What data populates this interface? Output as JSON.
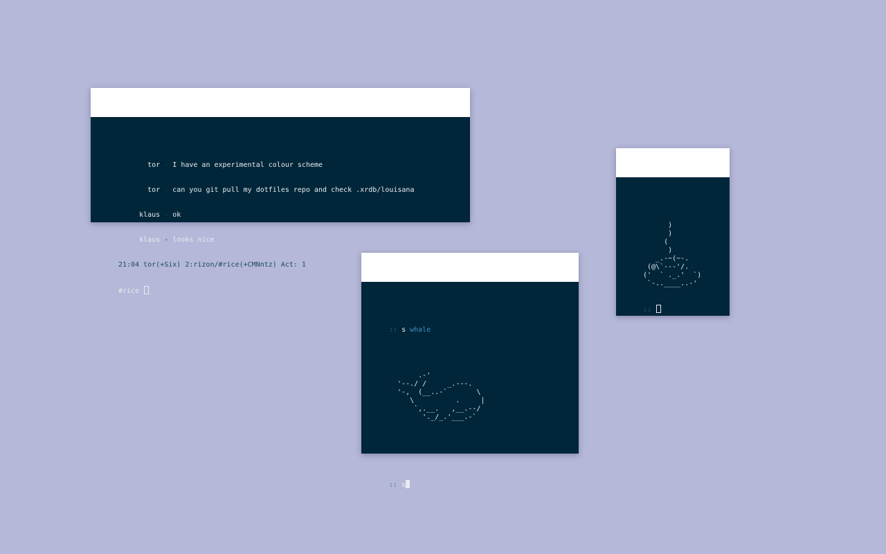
{
  "irc": {
    "messages": [
      {
        "nick": "       tor",
        "sep": " - ",
        "text": "I have an experimental colour scheme"
      },
      {
        "nick": "       tor",
        "sep": " - ",
        "text": "can you git pull my dotfiles repo and check .xrdb/louisana"
      },
      {
        "nick": "     klaus",
        "sep": " - ",
        "text": "ok"
      },
      {
        "nick": "     klaus",
        "sep": " - ",
        "text": "looks nice"
      }
    ],
    "status_line": "21:04 tor(+Six) 2:rizon/#rice(+CMNntz) Act: 1",
    "input_prompt": "#rice "
  },
  "whale": {
    "prompt_symbol": ":: ",
    "command": "s",
    "argument": "whale",
    "art": "       .-'\n  '--./ /     _.---.\n  '-,  (__..-`       \\\n     \\          .     |\n      `,.__.   ,__.--/\n        '._/_.'___.-`",
    "second_prompt_symbol": ":: ",
    "typed": "x"
  },
  "coffee": {
    "art": "      )\n      )\n     (\n      )\n   _.-~(~-.\n (@\\`---'/.\n('  ` ._.'  `)\n `-..____..-'",
    "prompt_symbol": ":: "
  },
  "colors": {
    "desktop": "#b5b8d8",
    "terminal_bg": "#012639",
    "titlebar": "#ffffff",
    "foreground": "#e8ecf0",
    "dim": "#1d4a62",
    "accent": "#3f8fc6"
  }
}
